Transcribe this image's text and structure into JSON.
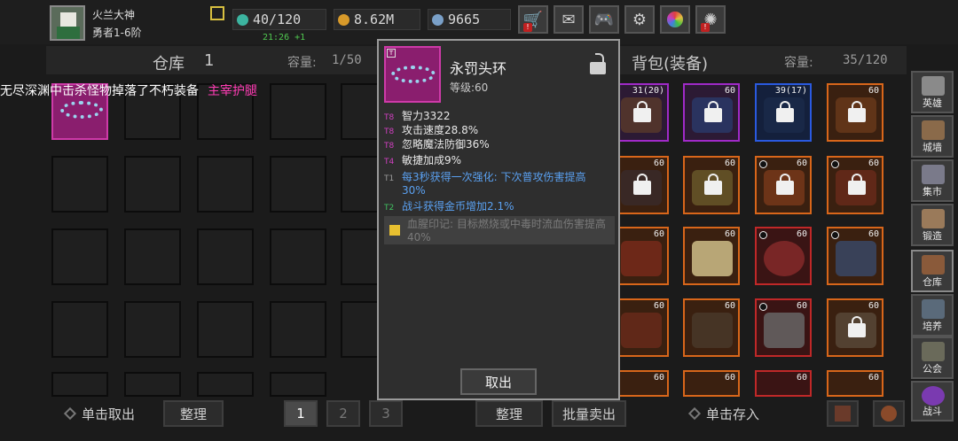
{
  "player": {
    "name": "火兰大神",
    "rank": "勇者1-6阶",
    "energy": "40/120",
    "gold": "8.62M",
    "gems": "9665",
    "timer": "21:26 +1"
  },
  "storage": {
    "title": "仓库",
    "page_num": "1",
    "capacity_label": "容量:",
    "capacity_value": "1/50"
  },
  "backpack": {
    "title": "背包(装备)",
    "capacity_label": "容量:",
    "capacity_value": "35/120",
    "levels": [
      "31(20)",
      "60",
      "39(17)",
      "60",
      "60",
      "60",
      "60",
      "60",
      "60",
      "60",
      "60",
      "60",
      "60",
      "60",
      "60",
      "60",
      "60",
      "60",
      "60",
      "60"
    ]
  },
  "broadcast": {
    "text": "无尽深渊中击杀怪物掉落了不朽装备",
    "highlight": "主宰护腿"
  },
  "tooltip": {
    "item_name": "永罚头环",
    "level": "等级:60",
    "stats": [
      {
        "tier": "T8",
        "text": "智力3322"
      },
      {
        "tier": "T8",
        "text": "攻击速度28.8%"
      },
      {
        "tier": "T8",
        "text": "忽略魔法防御36%"
      },
      {
        "tier": "T4",
        "text": "敏捷加成9%"
      },
      {
        "tier": "T1",
        "text": "每3秒获得一次强化: 下次普攻伤害提高30%"
      },
      {
        "tier": "T2",
        "text": "战斗获得金币增加2.1%"
      }
    ],
    "set_text": "血腥印记: 目标燃烧或中毒时流血伤害提高40%",
    "cancel": "取出"
  },
  "bottom": {
    "take_out": "单击取出",
    "sort_left": "整理",
    "pages": [
      "1",
      "2",
      "3"
    ],
    "sort_right": "整理",
    "bulk_sell": "批量卖出",
    "store": "单击存入"
  },
  "sidebar": [
    "英雄",
    "城墙",
    "集市",
    "锻造",
    "仓库",
    "培养",
    "公会",
    "战斗"
  ]
}
